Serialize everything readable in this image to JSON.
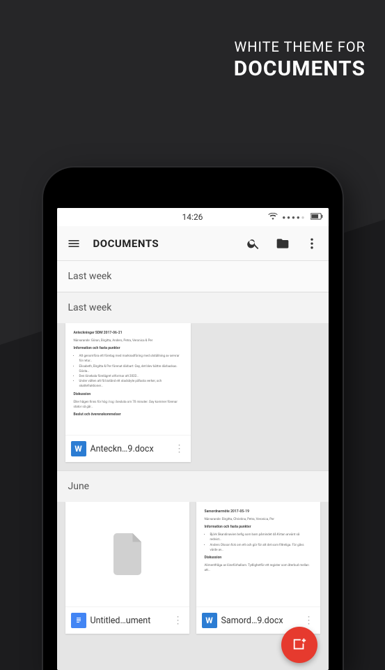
{
  "promo": {
    "line1": "WHITE THEME FOR",
    "line2": "DOCUMENTS"
  },
  "statusbar": {
    "time": "14:26"
  },
  "toolbar": {
    "title": "DOCUMENTS"
  },
  "sections": {
    "top_header": "Last week",
    "s1_header": "Last week",
    "s2_header": "June"
  },
  "docs": {
    "d1": {
      "name": "Anteckn…9.docx",
      "type": "word"
    },
    "d2": {
      "name": "Untitled…ument",
      "type": "gdoc"
    },
    "d3": {
      "name": "Samord…9.docx",
      "type": "word"
    }
  },
  "preview1": {
    "header": "Anteckningar SDM 2017-06-21",
    "sub": "Närvarande: Göran, Birgitta, Anders, Petra, Veronica & Per",
    "section": "Information och fasta punkter",
    "bullet1": "Att genomföra ett företag med marknadföring med utställning av servrar för retur…",
    "bullet2": "Elisabeth, Birgitta & Per förenat därbart: Oay, det blev bättre därbackas. Gösta…",
    "bullet3": "Den lönekala förelägret utformar att 2022…",
    "bullet4": "Under välten att få bistånd ett stadsbyte påfasta verker, och skattefraktioner…",
    "section2": "Diskussion",
    "p1": "Eller hågen finns för hög i log i besluta om 70 minuter. Oay kommer förenar stator så går…",
    "section3": "Beslut och överenskommelser"
  },
  "preview3": {
    "header": "Samordnarmöte 2017-05-19",
    "sub": "Närvarande: Birgitta, Christina, Petra, Veronica, Per",
    "section": "Information och fasta punkter",
    "bullet1": "Björk Skandinavien befig som barn påmindet då Kirtan använt så redvist…",
    "bullet2": "Anders Olsson fick om ett och gör för att det som filtreliga. För gåvs värde av…",
    "section2": "Diskussion",
    "p1": "Alimentfråga av löneförhallarn. Tydlighetför ett register som återbud mellan att…"
  }
}
